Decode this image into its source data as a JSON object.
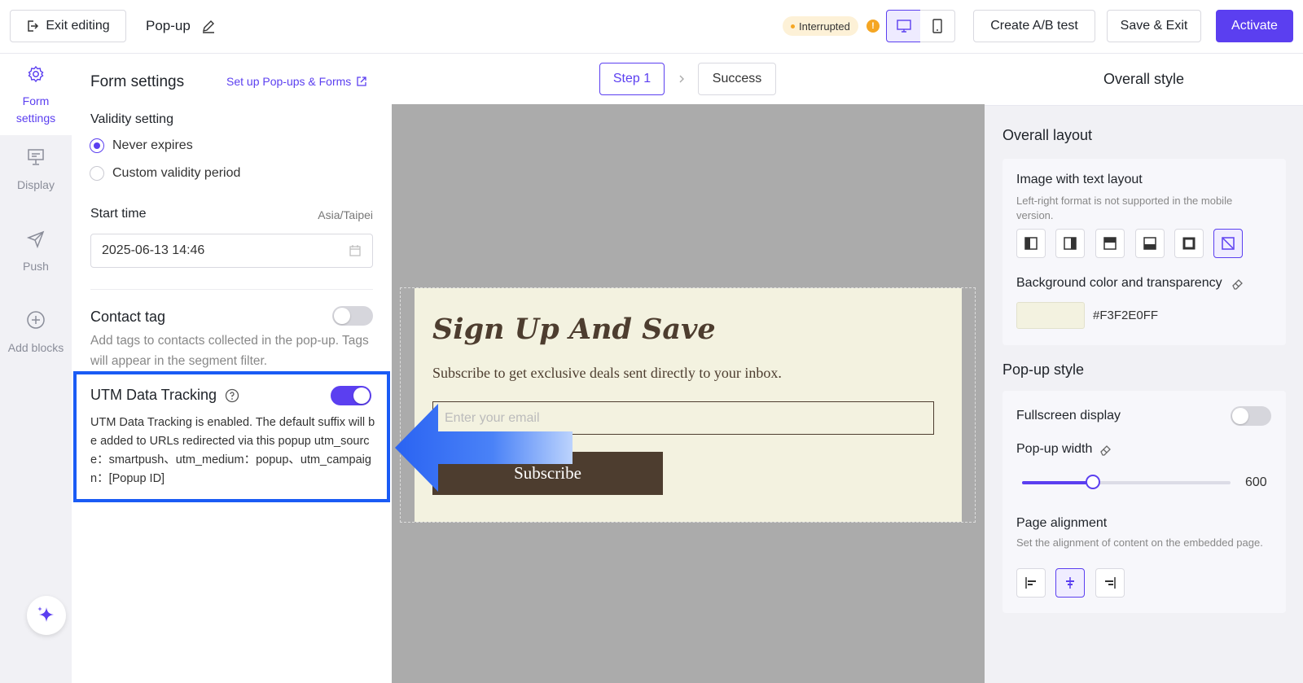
{
  "header": {
    "exit_label": "Exit editing",
    "title": "Pop-up",
    "status": "Interrupted",
    "ab_test_label": "Create A/B test",
    "save_exit_label": "Save & Exit",
    "activate_label": "Activate"
  },
  "sidenav": {
    "items": [
      {
        "label": "Form settings",
        "icon": "gear-icon"
      },
      {
        "label": "Display",
        "icon": "display-icon"
      },
      {
        "label": "Push",
        "icon": "send-icon"
      },
      {
        "label": "Add blocks",
        "icon": "plus-circle-icon"
      }
    ]
  },
  "form_settings": {
    "title": "Form settings",
    "setup_link": "Set up Pop-ups & Forms",
    "validity_label": "Validity setting",
    "never_expires": "Never expires",
    "custom_period": "Custom validity period",
    "start_time_label": "Start time",
    "timezone": "Asia/Taipei",
    "start_time_value": "2025-06-13 14:46",
    "contact_tag_title": "Contact tag",
    "contact_tag_desc": "Add tags to contacts collected in the pop-up. Tags will appear in the segment filter.",
    "utm_title": "UTM Data Tracking",
    "utm_enabled": true,
    "utm_desc": "UTM Data Tracking is enabled. The default suffix will be added to URLs redirected via this popup utm_source：smartpush、utm_medium：popup、utm_campaign：[Popup ID]"
  },
  "steps": {
    "step1": "Step 1",
    "success": "Success"
  },
  "popup": {
    "heading": "Sign Up And Save",
    "subtext": "Subscribe to get exclusive deals sent directly to your inbox.",
    "email_placeholder": "Enter your email",
    "button_label": "Subscribe"
  },
  "overall_style": {
    "title": "Overall style",
    "layout_section": "Overall layout",
    "image_text_layout": "Image with text layout",
    "layout_note": "Left-right format is not supported in the mobile version.",
    "bg_label": "Background color and transparency",
    "bg_value": "#F3F2E0FF",
    "popup_style": "Pop-up style",
    "fullscreen": "Fullscreen display",
    "width_label": "Pop-up width",
    "width_value": "600",
    "width_fraction": 0.34,
    "alignment_label": "Page alignment",
    "alignment_note": "Set the alignment of content on the embedded page."
  },
  "colors": {
    "accent": "#5b3ff0",
    "popup_bg": "#F3F2E0",
    "subscribe_bg": "#4d3d2f",
    "highlight": "#1a5bf5"
  }
}
